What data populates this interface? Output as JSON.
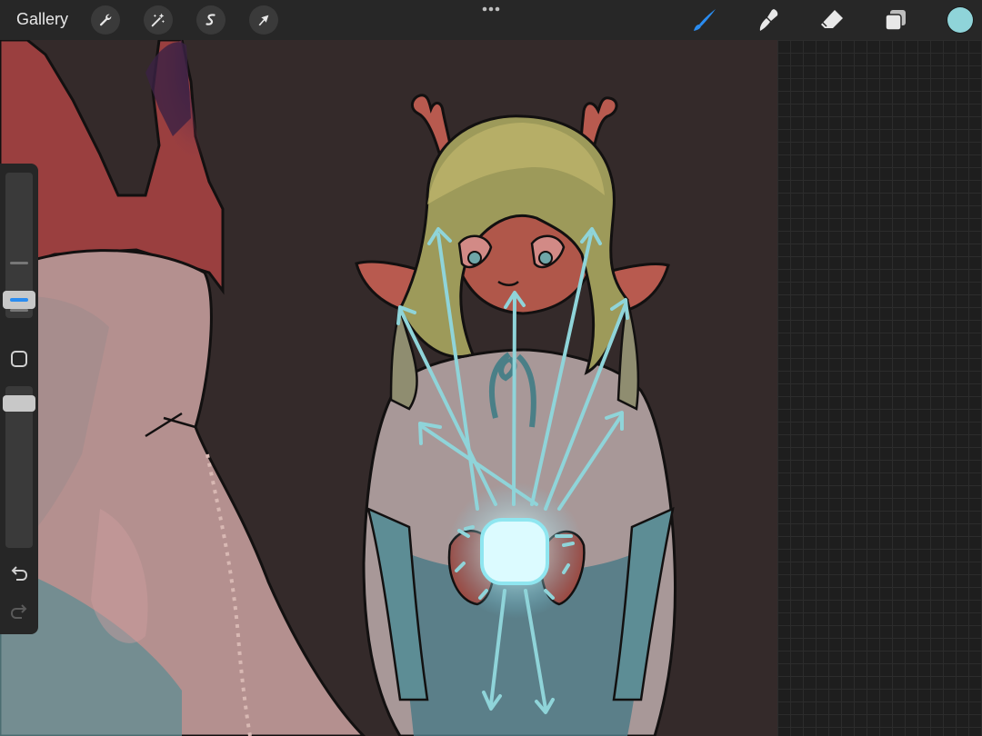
{
  "topbar": {
    "gallery_label": "Gallery",
    "actions": [
      {
        "name": "actions",
        "icon": "wrench-icon"
      },
      {
        "name": "adjustments",
        "icon": "magic-wand-icon"
      },
      {
        "name": "selection",
        "icon": "selection-s-icon"
      },
      {
        "name": "transform",
        "icon": "arrow-cursor-icon"
      }
    ],
    "more_icon": "three-dots-icon",
    "tools": [
      {
        "name": "brush",
        "icon": "brush-icon",
        "active": true
      },
      {
        "name": "smudge",
        "icon": "smudge-icon",
        "active": false
      },
      {
        "name": "eraser",
        "icon": "eraser-icon",
        "active": false
      },
      {
        "name": "layers",
        "icon": "layers-icon",
        "active": false
      }
    ],
    "current_color": "#8fd4d9",
    "active_tool_color": "#2a8cf0"
  },
  "sidebar": {
    "brush_size_slider": {
      "value": 0.45
    },
    "modify_button_icon": "square-outline-icon",
    "opacity_slider": {
      "value": 0.95
    },
    "undo_icon": "undo-icon",
    "redo_icon": "redo-icon"
  },
  "canvas": {
    "background": "#342a2a",
    "subject": "deer-girl-illustration"
  }
}
